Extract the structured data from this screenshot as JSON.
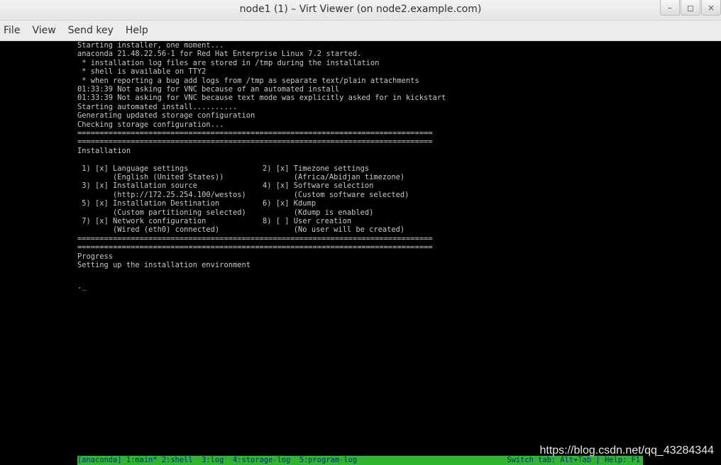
{
  "window": {
    "title": "node1 (1) – Virt Viewer (on node2.example.com)",
    "controls": [
      "–",
      "◻",
      "×"
    ]
  },
  "menu": [
    "File",
    "View",
    "Send key",
    "Help"
  ],
  "console": {
    "boot_lines": [
      "Starting installer, one moment...",
      "anaconda 21.48.22.56-1 for Red Hat Enterprise Linux 7.2 started.",
      " * installation log files are stored in /tmp during the installation",
      " * shell is available on TTY2",
      " * when reporting a bug add logs from /tmp as separate text/plain attachments",
      "01:33:39 Not asking for VNC because of an automated install",
      "01:33:39 Not asking for VNC because text mode was explicitly asked for in kickstart",
      "Starting automated install..........",
      "Generating updated storage configuration",
      "Checking storage configuration...",
      "================================================================================",
      "================================================================================",
      "Installation"
    ],
    "spokes_left": [
      " 1) [x] Language settings",
      "        (English (United States))",
      " 3) [x] Installation source",
      "        (http://172.25.254.100/westos)",
      " 5) [x] Installation Destination",
      "        (Custom partitioning selected)",
      " 7) [x] Network configuration",
      "        (Wired (eth0) connected)"
    ],
    "spokes_right": [
      "2) [x] Timezone settings",
      "       (Africa/Abidjan timezone)",
      "4) [x] Software selection",
      "       (Custom software selected)",
      "6) [x] Kdump",
      "       (Kdump is enabled)",
      "8) [ ] User creation",
      "       (No user will be created)"
    ],
    "separator": "================================================================================",
    "progress_heading": "Progress",
    "progress_line": "Setting up the installation environment",
    "cursor": "._",
    "status_left": "[anaconda] 1:main* 2:shell  3:log  4:storage-log  5:program-log",
    "status_right": "Switch tab: Alt+Tab | Help: F1"
  },
  "watermark": "https://blog.csdn.net/qq_43284344"
}
